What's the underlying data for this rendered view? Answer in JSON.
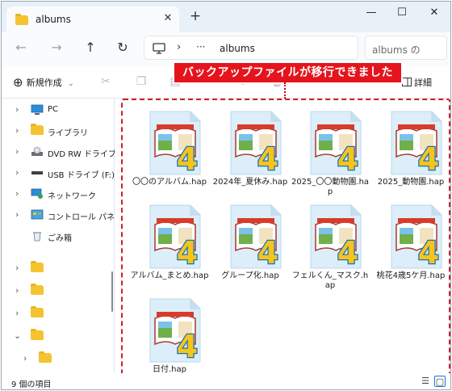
{
  "window": {
    "tab_title": "albums",
    "new_tab": "+",
    "close_tab": "✕"
  },
  "nav": {
    "back": "←",
    "forward": "→",
    "up": "↑",
    "refresh": "↻",
    "path_sep": "›",
    "path_more": "···",
    "path_current": "albums",
    "search_placeholder": "albums の"
  },
  "toolbar": {
    "new_label": "新規作成",
    "details_label": "詳細"
  },
  "banner": {
    "text": "バックアップファイルが移行できました"
  },
  "sidebar": {
    "items": [
      {
        "label": "PC",
        "icon": "pc-icon"
      },
      {
        "label": "ライブラリ",
        "icon": "folder-icon"
      },
      {
        "label": "DVD RW ドライブ",
        "icon": "dvd-drive-icon"
      },
      {
        "label": "USB ドライブ (F:)",
        "icon": "usb-drive-icon"
      },
      {
        "label": "ネットワーク",
        "icon": "network-icon"
      },
      {
        "label": "コントロール パネル",
        "icon": "control-panel-icon"
      },
      {
        "label": "ごみ箱",
        "icon": "recycle-bin-icon"
      }
    ]
  },
  "files": [
    {
      "name": "〇〇のアルバム.hap"
    },
    {
      "name": "2024年_夏休み.hap"
    },
    {
      "name": "2025_〇〇動物園.hap"
    },
    {
      "name": "2025_動物園.hap"
    },
    {
      "name": "アルバム_まとめ.hap"
    },
    {
      "name": "グループ化.hap"
    },
    {
      "name": "フェルくん_マスク.hap"
    },
    {
      "name": "桃花4歳5ケ月.hap"
    },
    {
      "name": "日付.hap"
    }
  ],
  "status": {
    "item_count": "9 個の項目"
  },
  "colors": {
    "accent": "#1a73e8",
    "banner": "#e5141c",
    "selection_border": "#cc1f1f",
    "folder": "#f4c430"
  }
}
